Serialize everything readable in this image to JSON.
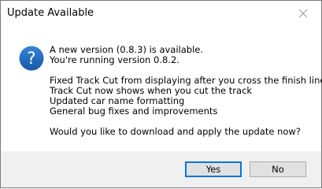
{
  "dialog": {
    "title": "Update Available",
    "message_lines": [
      "A new version (0.8.3) is available.",
      "You're running version 0.8.2.",
      "",
      "Fixed Track Cut from displaying after you cross the finish line",
      "Track Cut now shows when you cut the track",
      "Updated car name formatting",
      "General bug fixes and improvements",
      "",
      "Would you like to download and apply the update now?"
    ],
    "icon": "question-icon",
    "buttons": {
      "yes_label": "Yes",
      "no_label": "No"
    }
  },
  "colors": {
    "accent": "#0078d7",
    "footer_bg": "#f0f0f0",
    "icon_bg": "#1a66b8"
  }
}
